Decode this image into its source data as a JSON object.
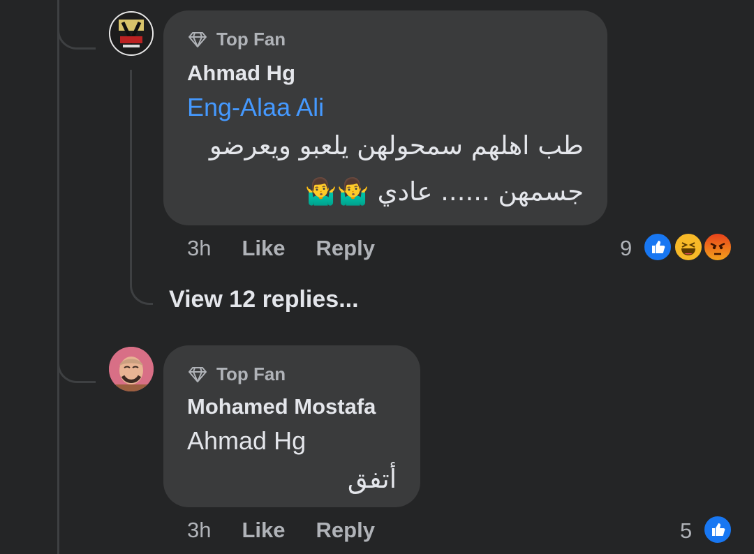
{
  "comments": [
    {
      "badge": "Top Fan",
      "author": "Ahmad Hg",
      "mention": "Eng-Alaa Ali",
      "line1": "طب اهلهم سمحولهن يلعبو ويعرضو",
      "line2": "جسمهن ...... عادي 🤷‍♂️🤷‍♂️",
      "time": "3h",
      "like_label": "Like",
      "reply_label": "Reply",
      "reaction_count": "9",
      "reactions": [
        "like-icon",
        "haha-icon",
        "angry-icon"
      ]
    },
    {
      "badge": "Top Fan",
      "author": "Mohamed Mostafa",
      "mention": "Ahmad Hg",
      "line1": "أتفق",
      "time": "3h",
      "like_label": "Like",
      "reply_label": "Reply",
      "reaction_count": "5",
      "reactions": [
        "like-icon"
      ]
    }
  ],
  "view_replies": "View 12 replies...",
  "colors": {
    "background": "#242526",
    "bubble": "#3a3b3c",
    "mention": "#4599ff",
    "like": "#1877f2",
    "haha": "#f7b928",
    "angry": "#e9710f"
  }
}
